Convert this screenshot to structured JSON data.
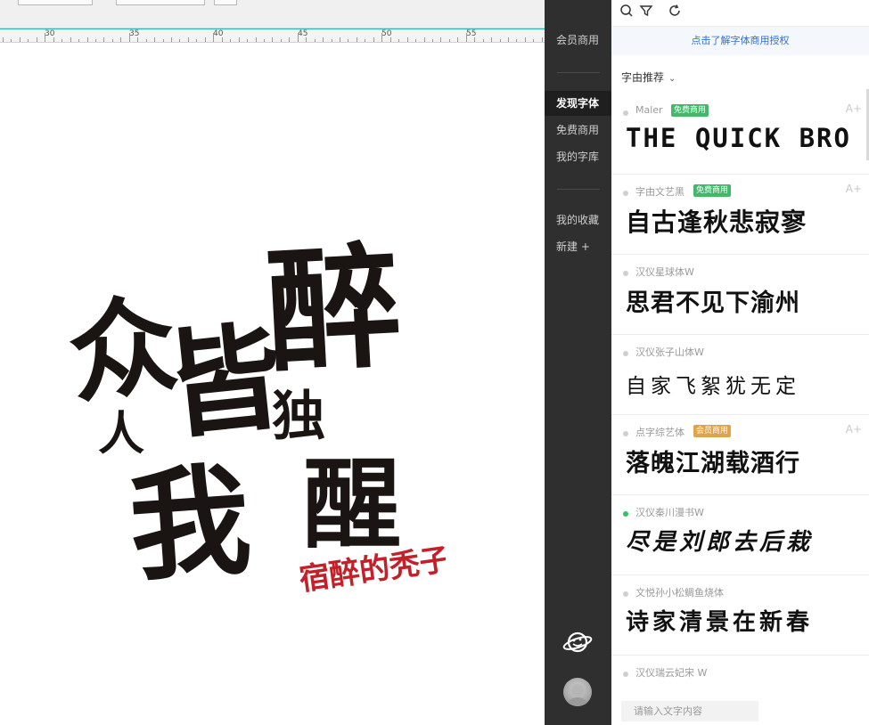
{
  "ruler": {
    "labels": [
      "30",
      "35",
      "40",
      "45",
      "50",
      "55"
    ]
  },
  "artwork": {
    "big_text": "众人皆醉我独醒",
    "stamp_text": "宿醉的秃子",
    "colors": {
      "ink": "#1a1512",
      "stamp": "#c4202a"
    }
  },
  "nav": {
    "items": [
      "会员商用",
      "发现字体",
      "免费商用",
      "我的字库",
      "我的收藏",
      "新建 +"
    ],
    "active": "发现字体"
  },
  "panel": {
    "toolbar_icons": [
      "search-icon",
      "filter-icon",
      "refresh-icon"
    ],
    "banner": "点击了解字体商用授权",
    "section_title": "字由推荐",
    "input_placeholder": "请输入文字内容",
    "fonts": [
      {
        "name": "Maler",
        "badge": "免费商用",
        "badge_type": "free",
        "sample": "THE QUICK BRO",
        "dot": "gray",
        "add_label": "A+"
      },
      {
        "name": "字由文艺黑",
        "badge": "免费商用",
        "badge_type": "free",
        "sample": "自古逢秋悲寂寥",
        "dot": "gray",
        "add_label": "A+"
      },
      {
        "name": "汉仪星球体W",
        "badge": "",
        "badge_type": "",
        "sample": "思君不见下渝州",
        "dot": "gray",
        "add_label": ""
      },
      {
        "name": "汉仪张子山体W",
        "badge": "",
        "badge_type": "",
        "sample": "自家飞絮犹无定",
        "dot": "gray",
        "add_label": ""
      },
      {
        "name": "点字综艺体",
        "badge": "会员商用",
        "badge_type": "vip",
        "sample": "落魄江湖载酒行",
        "dot": "gray",
        "add_label": "A+"
      },
      {
        "name": "汉仪秦川漫书W",
        "badge": "",
        "badge_type": "",
        "sample": "尽是刘郎去后栽",
        "dot": "green",
        "add_label": ""
      },
      {
        "name": "文悦孙小松鲷鱼烧体",
        "badge": "",
        "badge_type": "",
        "sample": "诗家清景在新春",
        "dot": "gray",
        "add_label": ""
      },
      {
        "name": "汉仪瑞云妃宋 W",
        "badge": "",
        "badge_type": "",
        "sample": "",
        "dot": "gray",
        "add_label": ""
      }
    ]
  }
}
